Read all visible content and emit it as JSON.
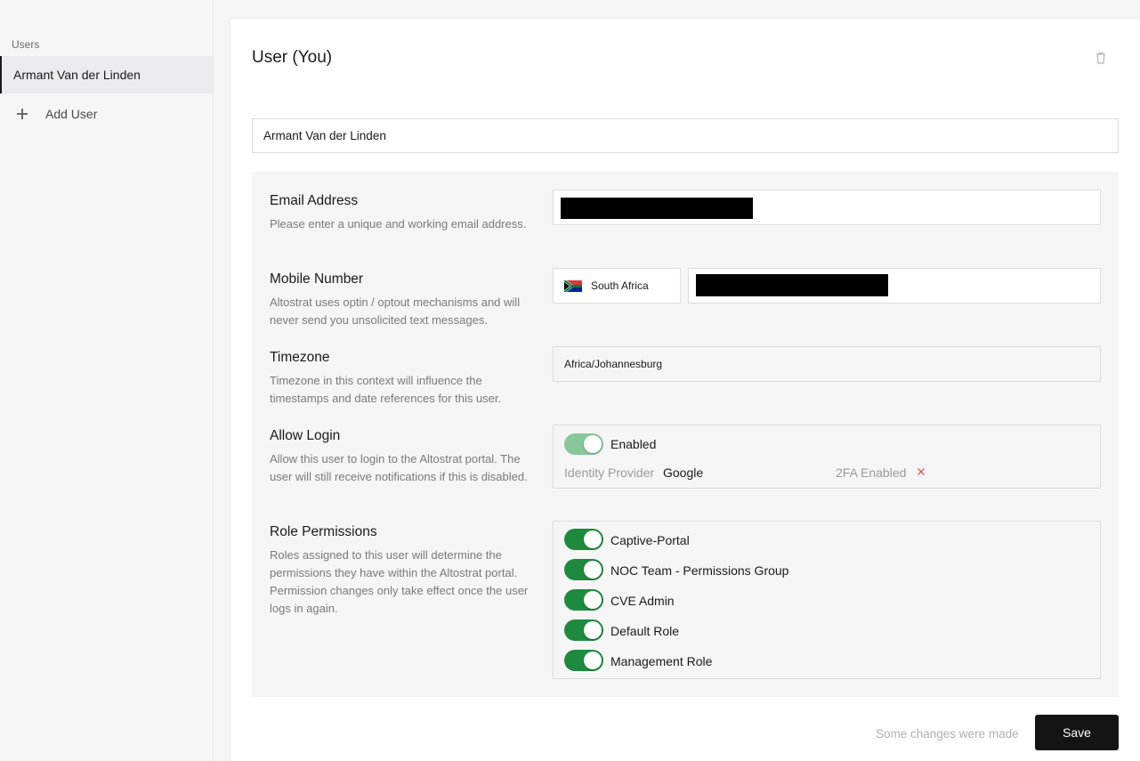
{
  "sidebar": {
    "heading": "Users",
    "items": [
      {
        "label": "Armant Van der Linden"
      }
    ],
    "add_user_label": "Add User"
  },
  "main": {
    "title": "User (You)",
    "name_value": "Armant Van der Linden"
  },
  "form": {
    "email": {
      "label": "Email Address",
      "description": "Please enter a unique and working email address."
    },
    "mobile": {
      "label": "Mobile Number",
      "description": "Altostrat uses optin / optout mechanisms and will never send you unsolicited text messages.",
      "country": "South Africa"
    },
    "timezone": {
      "label": "Timezone",
      "description": "Timezone in this context will influence the timestamps and date references for this user.",
      "value": "Africa/Johannesburg"
    },
    "allow_login": {
      "label": "Allow Login",
      "description": "Allow this user to login to the Altostrat portal. The user will still receive notifications if this is disabled.",
      "toggle_label": "Enabled",
      "enabled": true,
      "identity_provider_label": "Identity Provider",
      "identity_provider_value": "Google",
      "twofa_label": "2FA Enabled",
      "twofa_enabled": false
    },
    "roles": {
      "label": "Role Permissions",
      "description": "Roles assigned to this user will determine the permissions they have within the Altostrat portal. Permission changes only take effect once the user logs in again.",
      "items": [
        {
          "name": "Captive-Portal",
          "enabled": true
        },
        {
          "name": "NOC Team - Permissions Group",
          "enabled": true
        },
        {
          "name": "CVE Admin",
          "enabled": true
        },
        {
          "name": "Default Role",
          "enabled": true
        },
        {
          "name": "Management Role",
          "enabled": true
        }
      ]
    }
  },
  "footer": {
    "status": "Some changes were made",
    "save_label": "Save"
  },
  "colors": {
    "toggle_on": "#1e8a3e",
    "toggle_disabled": "#88c79a",
    "primary_button": "#141414",
    "twofa_off_icon": "#d94040"
  }
}
